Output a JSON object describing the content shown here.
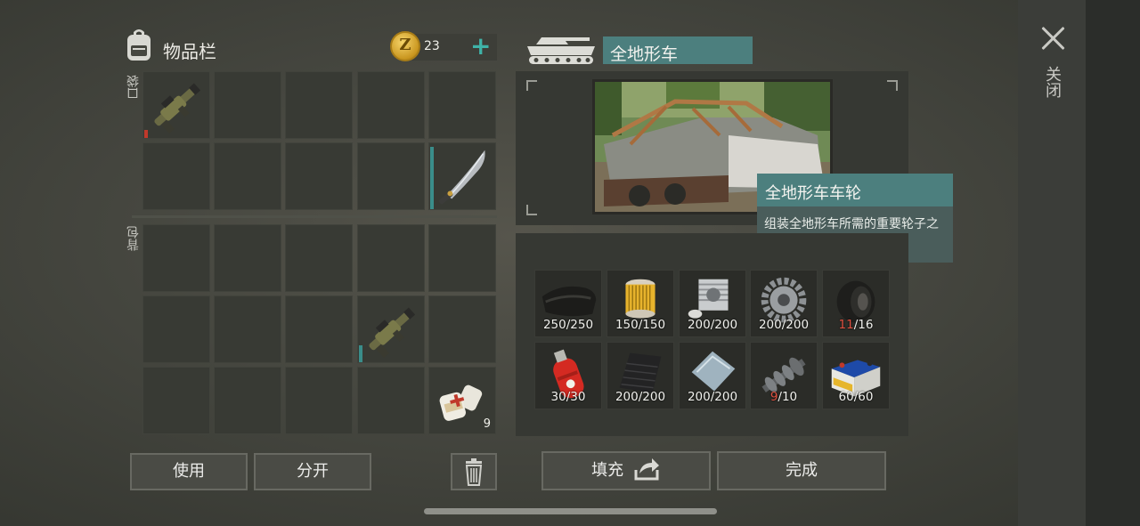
{
  "inventory": {
    "title": "物品栏",
    "coins": "23",
    "coin_symbol": "Z",
    "add_label": "+",
    "pocket_label": "口袋",
    "backpack_label": "背包",
    "pocket_slots": [
      {
        "item": "grenade-launcher",
        "qty_fraction": 0.12,
        "mark_color": "#c0392b"
      },
      {},
      {},
      {},
      {},
      {},
      {},
      {},
      {},
      {
        "item": "machete",
        "qty_fraction": 0.95,
        "mark_color": "#3a8d8a"
      }
    ],
    "backpack_slots": [
      {},
      {},
      {},
      {},
      {},
      {},
      {},
      {},
      {
        "item": "grenade-launcher",
        "qty_fraction": 0.25,
        "mark_color": "#3a8d8a"
      },
      {},
      {},
      {},
      {},
      {},
      {
        "item": "bandage",
        "count": "9"
      }
    ]
  },
  "buttons": {
    "use": "使用",
    "split": "分开",
    "fill": "填充",
    "done": "完成"
  },
  "close": {
    "label": "关闭"
  },
  "vehicle": {
    "name": "全地形车"
  },
  "tooltip": {
    "title": "全地形车车轮",
    "description": "组装全地形车所需的重要轮子之一"
  },
  "parts": [
    {
      "name": "rubber-sheet",
      "have": "250",
      "need": "250",
      "short": false
    },
    {
      "name": "air-filter",
      "have": "150",
      "need": "150",
      "short": false
    },
    {
      "name": "engine-block",
      "have": "200",
      "need": "200",
      "short": false
    },
    {
      "name": "gear",
      "have": "200",
      "need": "200",
      "short": false
    },
    {
      "name": "wheel",
      "have": "11",
      "need": "16",
      "short": true
    },
    {
      "name": "gas-canister",
      "have": "30",
      "need": "30",
      "short": false
    },
    {
      "name": "carbon-sheet",
      "have": "200",
      "need": "200",
      "short": false
    },
    {
      "name": "metal-plate",
      "have": "200",
      "need": "200",
      "short": false
    },
    {
      "name": "camshaft",
      "have": "9",
      "need": "10",
      "short": true
    },
    {
      "name": "car-battery",
      "have": "60",
      "need": "60",
      "short": false
    }
  ],
  "colors": {
    "accent_teal": "#4c7f7e",
    "shortage_red": "#e05040"
  }
}
